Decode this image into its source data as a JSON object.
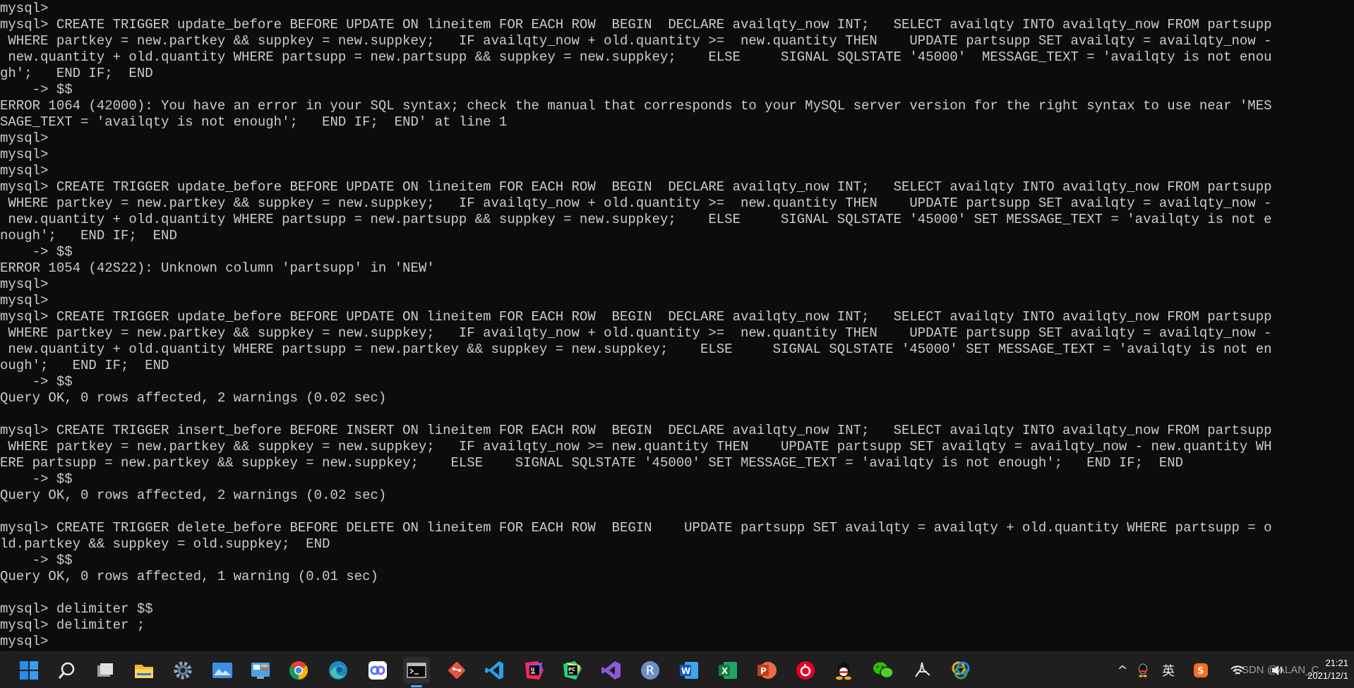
{
  "terminal": {
    "lines": [
      "mysql>",
      "mysql> CREATE TRIGGER update_before BEFORE UPDATE ON lineitem FOR EACH ROW  BEGIN  DECLARE availqty_now INT;   SELECT availqty INTO availqty_now FROM partsupp",
      " WHERE partkey = new.partkey && suppkey = new.suppkey;   IF availqty_now + old.quantity >=  new.quantity THEN    UPDATE partsupp SET availqty = availqty_now -",
      " new.quantity + old.quantity WHERE partsupp = new.partsupp && suppkey = new.suppkey;    ELSE     SIGNAL SQLSTATE '45000'  MESSAGE_TEXT = 'availqty is not enou",
      "gh';   END IF;  END",
      "    -> $$",
      "ERROR 1064 (42000): You have an error in your SQL syntax; check the manual that corresponds to your MySQL server version for the right syntax to use near 'MES",
      "SAGE_TEXT = 'availqty is not enough';   END IF;  END' at line 1",
      "mysql>",
      "mysql>",
      "mysql>",
      "mysql> CREATE TRIGGER update_before BEFORE UPDATE ON lineitem FOR EACH ROW  BEGIN  DECLARE availqty_now INT;   SELECT availqty INTO availqty_now FROM partsupp",
      " WHERE partkey = new.partkey && suppkey = new.suppkey;   IF availqty_now + old.quantity >=  new.quantity THEN    UPDATE partsupp SET availqty = availqty_now -",
      " new.quantity + old.quantity WHERE partsupp = new.partsupp && suppkey = new.suppkey;    ELSE     SIGNAL SQLSTATE '45000' SET MESSAGE_TEXT = 'availqty is not e",
      "nough';   END IF;  END",
      "    -> $$",
      "ERROR 1054 (42S22): Unknown column 'partsupp' in 'NEW'",
      "mysql>",
      "mysql>",
      "mysql> CREATE TRIGGER update_before BEFORE UPDATE ON lineitem FOR EACH ROW  BEGIN  DECLARE availqty_now INT;   SELECT availqty INTO availqty_now FROM partsupp",
      " WHERE partkey = new.partkey && suppkey = new.suppkey;   IF availqty_now + old.quantity >=  new.quantity THEN    UPDATE partsupp SET availqty = availqty_now -",
      " new.quantity + old.quantity WHERE partsupp = new.partkey && suppkey = new.suppkey;    ELSE     SIGNAL SQLSTATE '45000' SET MESSAGE_TEXT = 'availqty is not en",
      "ough';   END IF;  END",
      "    -> $$",
      "Query OK, 0 rows affected, 2 warnings (0.02 sec)",
      "",
      "mysql> CREATE TRIGGER insert_before BEFORE INSERT ON lineitem FOR EACH ROW  BEGIN  DECLARE availqty_now INT;   SELECT availqty INTO availqty_now FROM partsupp",
      " WHERE partkey = new.partkey && suppkey = new.suppkey;   IF availqty_now >= new.quantity THEN    UPDATE partsupp SET availqty = availqty_now - new.quantity WH",
      "ERE partsupp = new.partkey && suppkey = new.suppkey;    ELSE    SIGNAL SQLSTATE '45000' SET MESSAGE_TEXT = 'availqty is not enough';   END IF;  END",
      "    -> $$",
      "Query OK, 0 rows affected, 2 warnings (0.02 sec)",
      "",
      "mysql> CREATE TRIGGER delete_before BEFORE DELETE ON lineitem FOR EACH ROW  BEGIN    UPDATE partsupp SET availqty = availqty + old.quantity WHERE partsupp = o",
      "ld.partkey && suppkey = old.suppkey;  END",
      "    -> $$",
      "Query OK, 0 rows affected, 1 warning (0.01 sec)",
      "",
      "mysql> delimiter $$",
      "mysql> delimiter ;",
      "mysql>"
    ]
  },
  "colors": {
    "terminal_background": "#0c0c0c",
    "terminal_text": "#cccccc",
    "taskbar_background": "#1f1f1f"
  },
  "taskbar": {
    "apps": [
      {
        "name": "start-icon",
        "running": false
      },
      {
        "name": "search-icon",
        "running": false
      },
      {
        "name": "task-view-icon",
        "running": false
      },
      {
        "name": "file-explorer-icon",
        "running": false
      },
      {
        "name": "settings-gear-icon",
        "running": false
      },
      {
        "name": "photos-icon",
        "running": false
      },
      {
        "name": "control-panel-icon",
        "running": false
      },
      {
        "name": "chrome-icon",
        "running": false
      },
      {
        "name": "edge-icon",
        "running": false
      },
      {
        "name": "baidu-netdisk-icon",
        "running": false
      },
      {
        "name": "terminal-icon",
        "running": true,
        "active": true
      },
      {
        "name": "git-icon",
        "running": false
      },
      {
        "name": "vscode-icon",
        "running": false
      },
      {
        "name": "intellij-idea-icon",
        "running": false
      },
      {
        "name": "pycharm-icon",
        "running": false
      },
      {
        "name": "visual-studio-icon",
        "running": false
      },
      {
        "name": "r-language-icon",
        "running": false
      },
      {
        "name": "word-icon",
        "running": false
      },
      {
        "name": "excel-icon",
        "running": false
      },
      {
        "name": "powerpoint-icon",
        "running": false
      },
      {
        "name": "netease-music-icon",
        "running": false
      },
      {
        "name": "qq-icon",
        "running": false
      },
      {
        "name": "wechat-icon",
        "running": false
      },
      {
        "name": "acrobat-icon",
        "running": false
      },
      {
        "name": "color-app-icon",
        "running": false
      }
    ],
    "tray": {
      "chevron": "^",
      "ime_label": "英",
      "clock_time": "21:21",
      "clock_date": "2021/12/1",
      "watermark": "CSDN @ALAN_C"
    }
  }
}
